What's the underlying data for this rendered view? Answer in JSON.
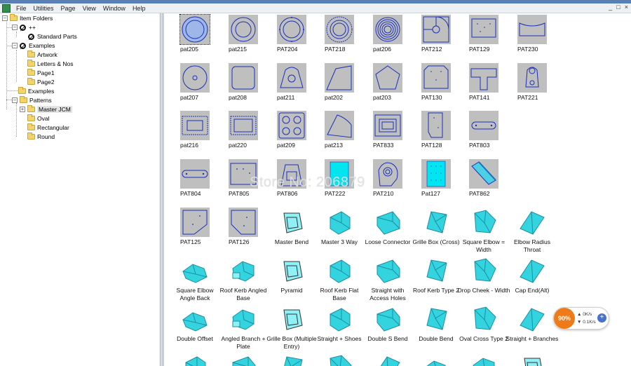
{
  "menubar": {
    "items": [
      "File",
      "Utilities",
      "Page",
      "View",
      "Window",
      "Help"
    ],
    "controls": [
      "_",
      "□",
      "×"
    ]
  },
  "tree": {
    "root": "Item Folders",
    "nodes": [
      {
        "label": "++",
        "type": "no"
      },
      {
        "label": "Standard Parts",
        "type": "no"
      },
      {
        "label": "Examples",
        "type": "no"
      },
      {
        "label": "Artwork",
        "type": "folder"
      },
      {
        "label": "Letters & Nos",
        "type": "folder"
      },
      {
        "label": "Page1",
        "type": "folder"
      },
      {
        "label": "Page2",
        "type": "folder"
      },
      {
        "label": "Examples",
        "type": "folder"
      },
      {
        "label": "Patterns",
        "type": "folder"
      },
      {
        "label": "Master JCM",
        "type": "folder"
      },
      {
        "label": "Oval",
        "type": "folder"
      },
      {
        "label": "Rectangular",
        "type": "folder"
      },
      {
        "label": "Round",
        "type": "folder"
      }
    ]
  },
  "items": {
    "row1": [
      "pat205",
      "pat215",
      "PAT204",
      "PAT218",
      "pat206",
      "PAT212",
      "PAT129",
      "PAT230"
    ],
    "row2": [
      "pat207",
      "pat208",
      "pat211",
      "pat202",
      "pat203",
      "PAT130",
      "PAT141",
      "PAT221"
    ],
    "row3": [
      "pat216",
      "pat220",
      "pat209",
      "pat213",
      "PAT833",
      "PAT128",
      "PAT803"
    ],
    "row4": [
      "PAT804",
      "PAT805",
      "PAT806",
      "PAT222",
      "PAT210",
      "Pat127",
      "PAT862"
    ],
    "row5": [
      "PAT125",
      "PAT126",
      "Master Bend",
      "Master 3 Way",
      "Loose Connector",
      "Grille Box (Cross)",
      "Square Elbow = Width",
      "Elbow Radius Throat"
    ],
    "row6": [
      "Square Elbow Angle Back",
      "Roof Kerb Angled Base",
      "Pyramid",
      "Roof Kerb Flat Base",
      "Straight with Access Holes",
      "Roof Kerb Type 2",
      "Drop Cheek - Width",
      "Cap End(Alt)"
    ],
    "row7": [
      "Double Offset",
      "Angled Branch + Plate",
      "Grille Box (Multiple Entry)",
      "Straight + Shoes",
      "Double S Bend",
      "Double Bend",
      "Oval Cross Type 2",
      "Straight + Branches"
    ]
  },
  "watermark": "Store No: 206879",
  "net_widget": {
    "percent": "90%",
    "up": "0K/s",
    "down": "0.1K/s",
    "plus": "+"
  },
  "colors": {
    "thumb_bg": "#bfbfbf",
    "outline_blue": "#1a2fb8",
    "duct_cyan": "#33d4e0",
    "accent_orange": "#f07a17"
  }
}
